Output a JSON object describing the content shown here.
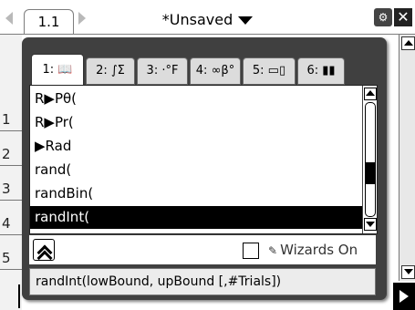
{
  "window": {
    "page_tab": "1.1",
    "document_title": "*Unsaved",
    "battery_icon": "battery-settings-icon",
    "close_icon": "close-icon"
  },
  "background_doc": {
    "row_numbers": [
      "1",
      "2",
      "3",
      "4",
      "5"
    ]
  },
  "catalog": {
    "tabs": [
      {
        "label": "1: 📖",
        "name": "tab-alphabetical"
      },
      {
        "label": "2: ∫Σ",
        "name": "tab-math-templates"
      },
      {
        "label": "3: ·°F",
        "name": "tab-units"
      },
      {
        "label": "4: ∞β°",
        "name": "tab-symbols"
      },
      {
        "label": "5: ▭▯",
        "name": "tab-math-expression-templates"
      },
      {
        "label": "6: ▮▮",
        "name": "tab-libraries"
      }
    ],
    "active_tab": 0,
    "items": [
      "R▶Pθ(",
      "R▶Pr(",
      "▶Rad",
      "rand(",
      "randBin(",
      "randInt("
    ],
    "selected_index": 5,
    "wizards_label": "Wizards On",
    "wizards_checked": false,
    "syntax_help": "randInt(lowBound, upBound [,#Trials])"
  }
}
